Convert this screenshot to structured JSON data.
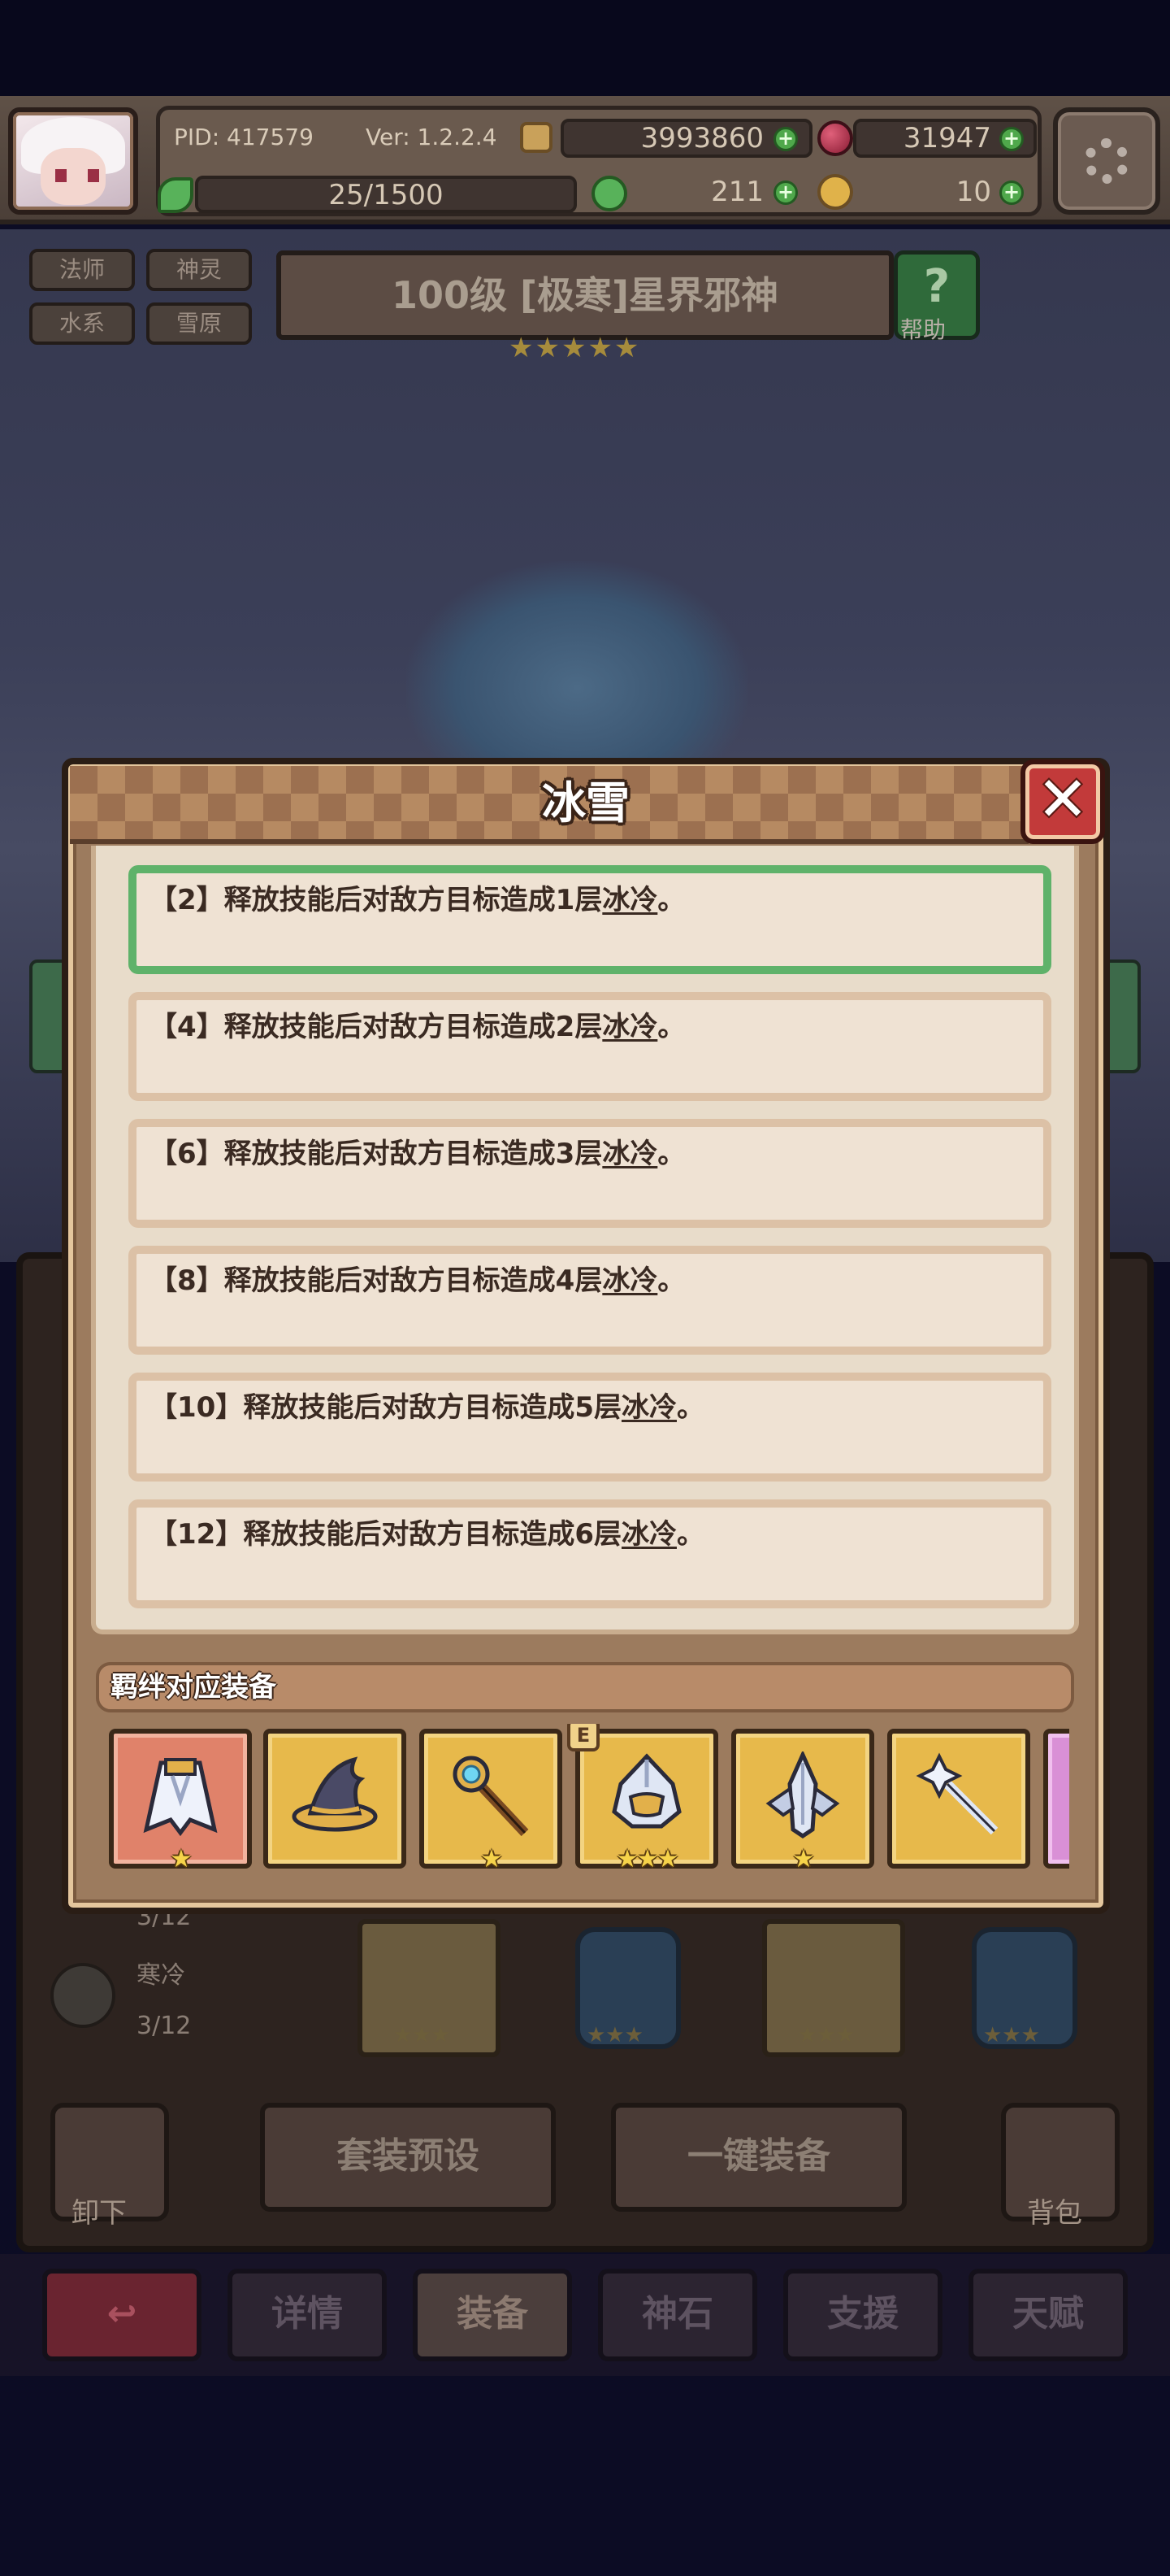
{
  "header": {
    "pid": "PID: 417579",
    "version": "Ver: 1.2.2.4",
    "gold": "3993860",
    "gems": "31947",
    "stamina": "25/1500",
    "clover": "211",
    "chicken": "10",
    "settings_icon": "gear-icon"
  },
  "hero": {
    "tags": [
      "法师",
      "神灵",
      "水系",
      "雪原"
    ],
    "title": "100级 [极寒]星界邪神",
    "stars": "★★★★★",
    "help_label": "帮助",
    "help_icon": "?"
  },
  "modal": {
    "title": "冰雪",
    "close_icon": "close-icon",
    "bonuses": [
      {
        "level": "【2】",
        "text": "释放技能后对敌方目标造成1层",
        "keyword": "冰冷",
        "end": "。"
      },
      {
        "level": "【4】",
        "text": "释放技能后对敌方目标造成2层",
        "keyword": "冰冷",
        "end": "。"
      },
      {
        "level": "【6】",
        "text": "释放技能后对敌方目标造成3层",
        "keyword": "冰冷",
        "end": "。"
      },
      {
        "level": "【8】",
        "text": "释放技能后对敌方目标造成4层",
        "keyword": "冰冷",
        "end": "。"
      },
      {
        "level": "【10】",
        "text": "释放技能后对敌方目标造成5层",
        "keyword": "冰冷",
        "end": "。"
      },
      {
        "level": "【12】",
        "text": "释放技能后对敌方目标造成6层",
        "keyword": "冰冷",
        "end": "。"
      }
    ],
    "active_bonus_index": 0,
    "bond_title": "羁绊对应装备",
    "bond_items": [
      {
        "name": "cape-icon",
        "stars": "★"
      },
      {
        "name": "wizard-hat-icon",
        "stars": ""
      },
      {
        "name": "ice-staff-icon",
        "stars": "★"
      },
      {
        "name": "ice-helmet-icon",
        "stars": "★★★",
        "badge": "E"
      },
      {
        "name": "ice-crystal-icon",
        "stars": "★"
      },
      {
        "name": "ice-wand-icon",
        "stars": ""
      }
    ]
  },
  "lower": {
    "list_rows": [
      "3/12",
      "寒冷",
      "3/12"
    ],
    "slot_stars": "★★★",
    "preset_button": "套装预设",
    "equip_button": "一键装备",
    "unequip_label": "卸下",
    "bag_label": "背包"
  },
  "nav": {
    "items": [
      "详情",
      "装备",
      "神石",
      "支援",
      "天赋"
    ],
    "active_index": 1
  },
  "colors": {
    "active_border": "#5fb26a",
    "modal_bg": "#e8dcca",
    "item_border": "#dcc1a6"
  }
}
